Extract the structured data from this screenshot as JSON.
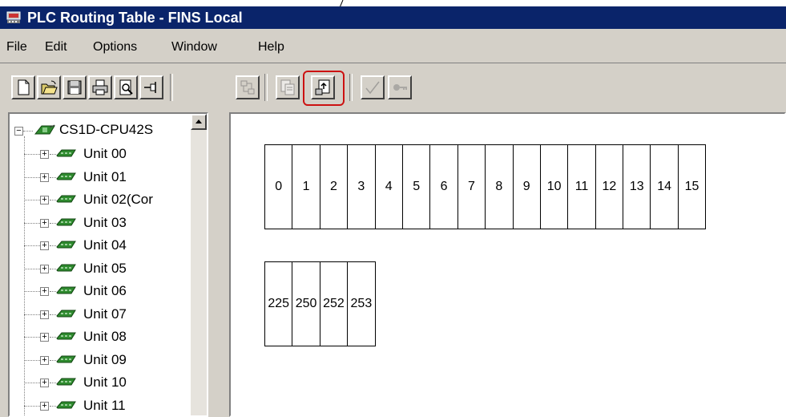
{
  "window": {
    "title": "PLC Routing Table - FINS Local"
  },
  "menu": [
    "File",
    "Edit",
    "Options",
    "Window",
    "Help"
  ],
  "toolbar": {
    "buttons": [
      {
        "name": "new-file-button",
        "icon": "new-file-icon",
        "enabled": true
      },
      {
        "name": "open-button",
        "icon": "open-folder-icon",
        "enabled": true
      },
      {
        "name": "save-button",
        "icon": "floppy-disk-icon",
        "enabled": true
      },
      {
        "name": "print-button",
        "icon": "printer-icon",
        "enabled": true
      },
      {
        "name": "print-preview-button",
        "icon": "print-preview-icon",
        "enabled": true
      },
      {
        "name": "pin-button",
        "icon": "pin-icon",
        "enabled": true
      },
      {
        "name": "network-button",
        "icon": "network-icon",
        "enabled": false
      },
      {
        "name": "compare-button",
        "icon": "compare-icon",
        "enabled": false
      },
      {
        "name": "transfer-from-plc-button",
        "icon": "upload-from-plc-icon",
        "enabled": true,
        "highlighted": true
      },
      {
        "name": "check-button",
        "icon": "checkmark-icon",
        "enabled": false
      },
      {
        "name": "key-button",
        "icon": "key-icon",
        "enabled": false
      }
    ]
  },
  "tree": {
    "root": "CS1D-CPU42S",
    "units": [
      "Unit 00",
      "Unit 01",
      "Unit 02(Cor",
      "Unit 03",
      "Unit 04",
      "Unit 05",
      "Unit 06",
      "Unit 07",
      "Unit 08",
      "Unit 09",
      "Unit 10",
      "Unit 11"
    ]
  },
  "main": {
    "row1": [
      "0",
      "1",
      "2",
      "3",
      "4",
      "5",
      "6",
      "7",
      "8",
      "9",
      "10",
      "11",
      "12",
      "13",
      "14",
      "15"
    ],
    "row2": [
      "225",
      "250",
      "252",
      "253"
    ]
  },
  "colors": {
    "titlebar": "#0a246a",
    "highlight": "#cc1111",
    "unit_icon": "#2e8b2e",
    "face": "#d4d0c8"
  }
}
